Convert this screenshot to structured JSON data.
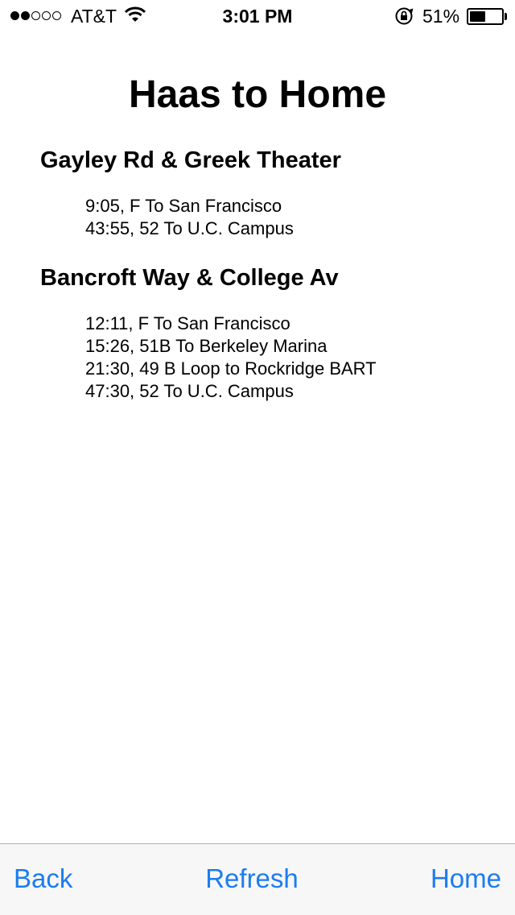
{
  "status_bar": {
    "carrier": "AT&T",
    "time": "3:01 PM",
    "battery_percent": "51%",
    "battery_level": 0.51,
    "signal_bars_filled": 2,
    "signal_bars_total": 5
  },
  "page": {
    "title": "Haas to Home"
  },
  "stops": [
    {
      "name": "Gayley Rd & Greek Theater",
      "departures": [
        "9:05, F To San Francisco",
        "43:55, 52 To U.C. Campus"
      ]
    },
    {
      "name": "Bancroft Way & College Av",
      "departures": [
        "12:11, F To San Francisco",
        "15:26, 51B To Berkeley Marina",
        "21:30, 49 B Loop to Rockridge BART",
        "47:30, 52 To U.C. Campus"
      ]
    }
  ],
  "toolbar": {
    "back_label": "Back",
    "refresh_label": "Refresh",
    "home_label": "Home"
  },
  "colors": {
    "accent": "#1b7cf0",
    "toolbar_bg": "#f7f7f7"
  }
}
